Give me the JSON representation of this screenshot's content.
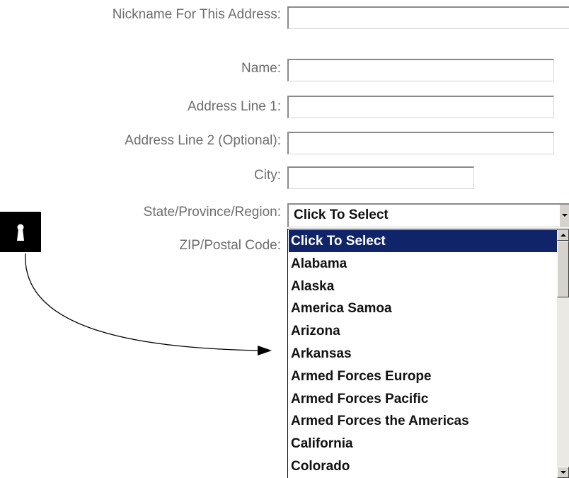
{
  "form": {
    "nickname_label": "Nickname For This Address:",
    "name_label": "Name:",
    "address1_label": "Address Line 1:",
    "address2_label": "Address Line 2 (Optional):",
    "city_label": "City:",
    "state_label": "State/Province/Region:",
    "zip_label": "ZIP/Postal Code:",
    "state_selected": "Click To Select"
  },
  "state_options": [
    "Click To Select",
    "Alabama",
    "Alaska",
    "America Samoa",
    "Arizona",
    "Arkansas",
    "Armed Forces Europe",
    "Armed Forces Pacific",
    "Armed Forces the Americas",
    "California",
    "Colorado"
  ],
  "selected_option_index": 0,
  "colors": {
    "selection_bg": "#10246a",
    "selection_text": "#ffffff",
    "label_text": "#6d6d6d",
    "badge": "#000000"
  },
  "annotation": {
    "badge_icon": "keyhole-icon"
  }
}
